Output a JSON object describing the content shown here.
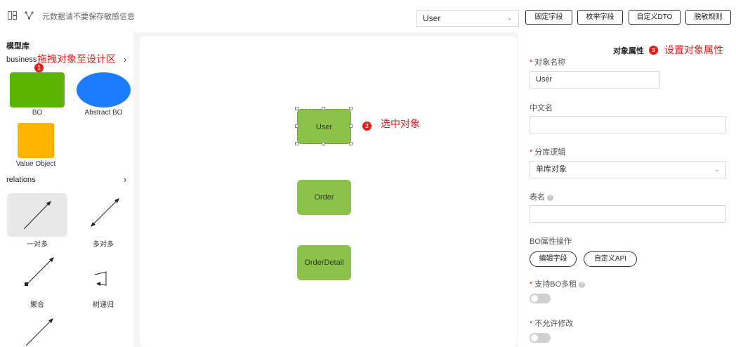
{
  "toolbar": {
    "hint": "元数据请不要保存敏感信息",
    "object_select": {
      "value": "User"
    },
    "buttons": [
      "固定字段",
      "枚举字段",
      "自定义DTO",
      "脱敏规则"
    ],
    "icons": [
      "layout-icon",
      "relation-icon"
    ]
  },
  "left_panel": {
    "title": "模型库",
    "business": {
      "header": "business",
      "annotation": "拖拽对象至设计区",
      "badge": "1",
      "items": [
        {
          "label": "BO",
          "shape": "rect",
          "color": "#5cb300"
        },
        {
          "label": "Abstract BO",
          "shape": "ellipse",
          "color": "#1a7cff"
        },
        {
          "label": "Value Object",
          "shape": "square",
          "color": "#ffb400"
        }
      ]
    },
    "relations": {
      "header": "relations",
      "items": [
        "一对多",
        "多对多",
        "聚合",
        "树递归",
        ""
      ]
    }
  },
  "canvas": {
    "annotation": "选中对象",
    "badge": "2",
    "nodes": [
      {
        "label": "User",
        "selected": true
      },
      {
        "label": "Order",
        "selected": false
      },
      {
        "label": "OrderDetail",
        "selected": false
      }
    ],
    "node_color": "#8bc34a"
  },
  "right_panel": {
    "title": "对象属性",
    "badge": "3",
    "annotation": "设置对象属性",
    "fields": {
      "object_name": {
        "label": "对象名称",
        "value": "User",
        "required": true
      },
      "chinese_name": {
        "label": "中文名",
        "value": ""
      },
      "shard_logic": {
        "label": "分库逻辑",
        "value": "单库对象",
        "required": true
      },
      "table_name": {
        "label": "表名",
        "value": ""
      },
      "bo_ops": {
        "label": "BO属性操作",
        "buttons": [
          "编辑字段",
          "自定义API"
        ]
      },
      "multi_tenant": {
        "label": "支持BO多租",
        "required": true,
        "on": false
      },
      "no_modify": {
        "label": "不允许修改",
        "required": true,
        "on": false
      }
    }
  },
  "colors": {
    "accent_red": "#e0201c",
    "node_green": "#8bc34a"
  }
}
